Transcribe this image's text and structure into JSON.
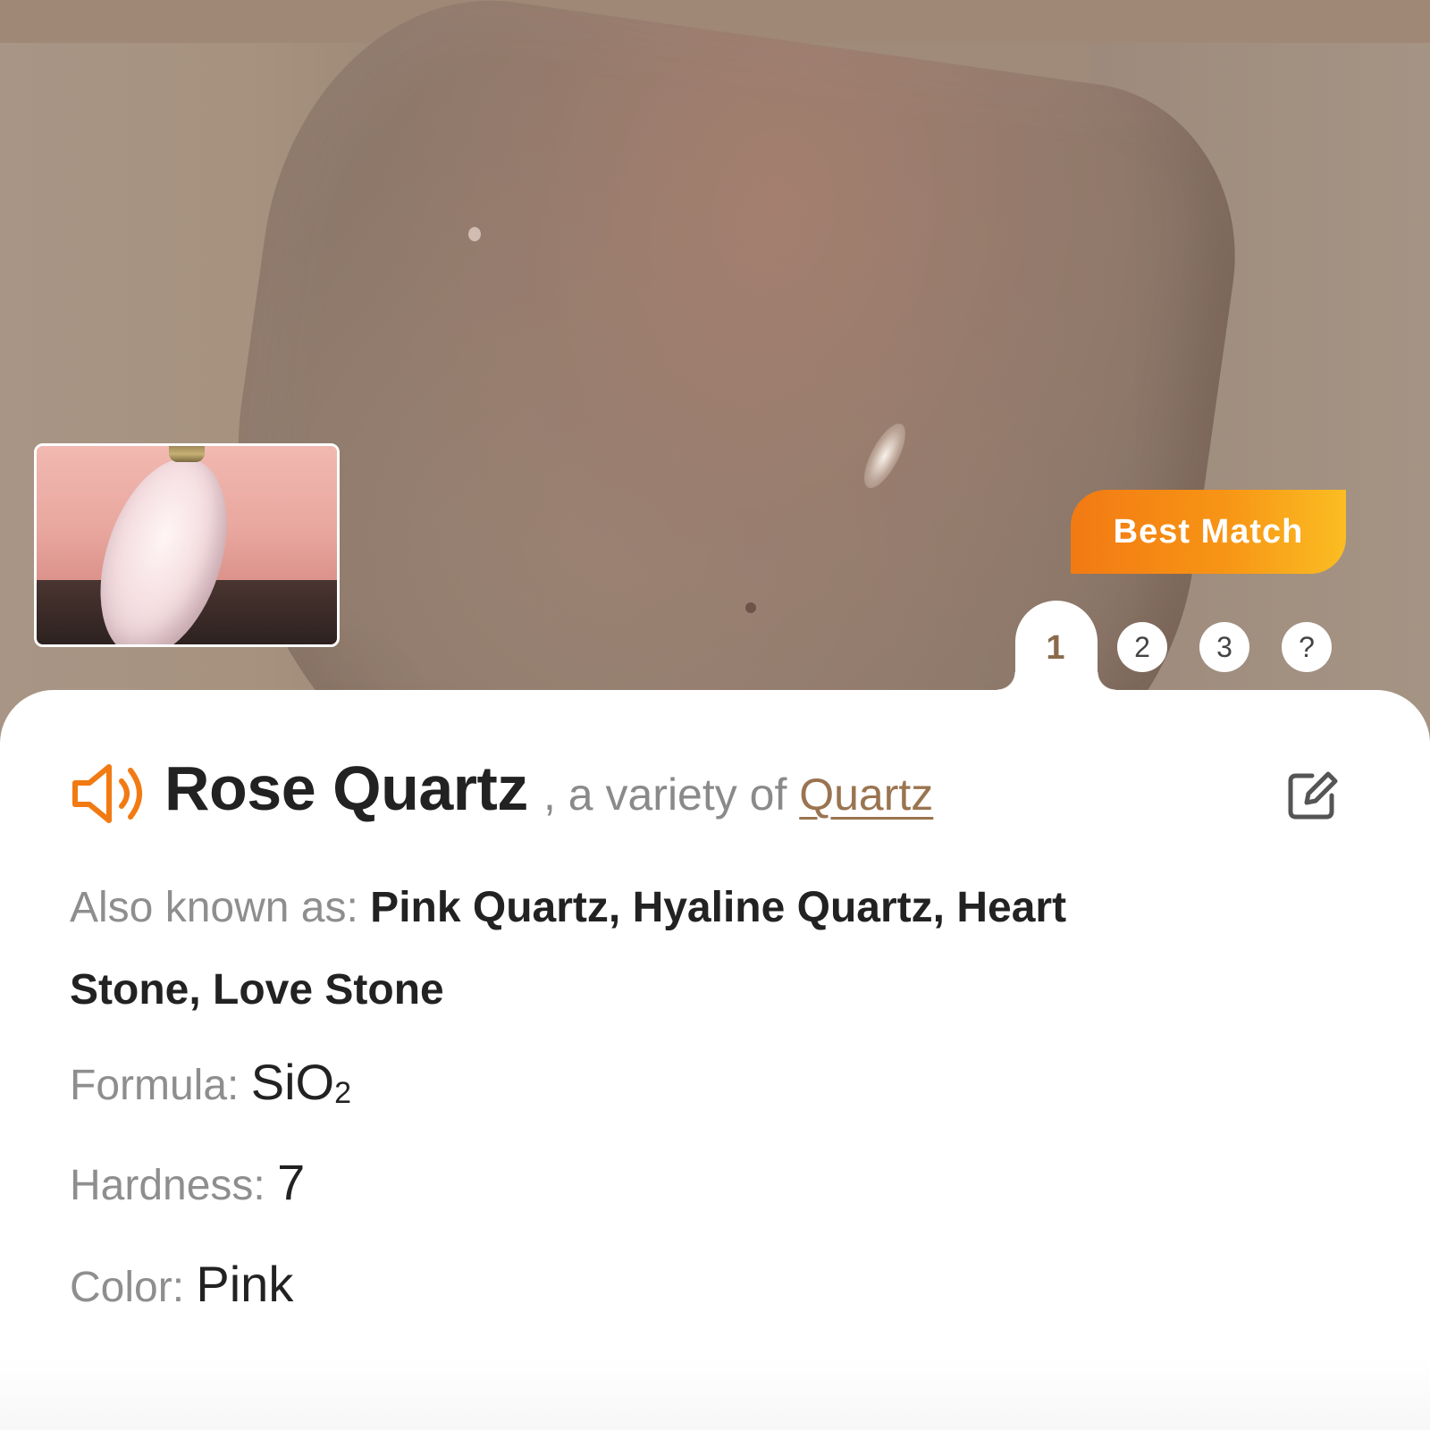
{
  "hero": {
    "image_subject": "rose quartz tumbled stone photo",
    "thumbnail_subject": "rose quartz pendant held between fingers",
    "badge": "Best Match"
  },
  "tabs": {
    "items": [
      "1",
      "2",
      "3",
      "?"
    ],
    "active": "1"
  },
  "result": {
    "name": "Rose Quartz",
    "variety_prefix": ", a variety of ",
    "variety_link": "Quartz",
    "speaker_icon": "speaker-icon",
    "edit_icon": "edit-icon"
  },
  "properties": {
    "aka_label": "Also known as: ",
    "aka_value_line1": "Pink Quartz, Hyaline Quartz, Heart",
    "aka_value_line2": "Stone, Love Stone",
    "formula_label": "Formula: ",
    "formula_main": "SiO",
    "formula_sub": "2",
    "hardness_label": "Hardness: ",
    "hardness_value": "7",
    "color_label": "Color: ",
    "color_value": "Pink"
  },
  "colors": {
    "accent_orange": "#f27a13",
    "badge_gradient_end": "#fbbd22",
    "link_brown": "#9a7450",
    "label_gray": "#8e8e8e",
    "text_dark": "#222222"
  }
}
